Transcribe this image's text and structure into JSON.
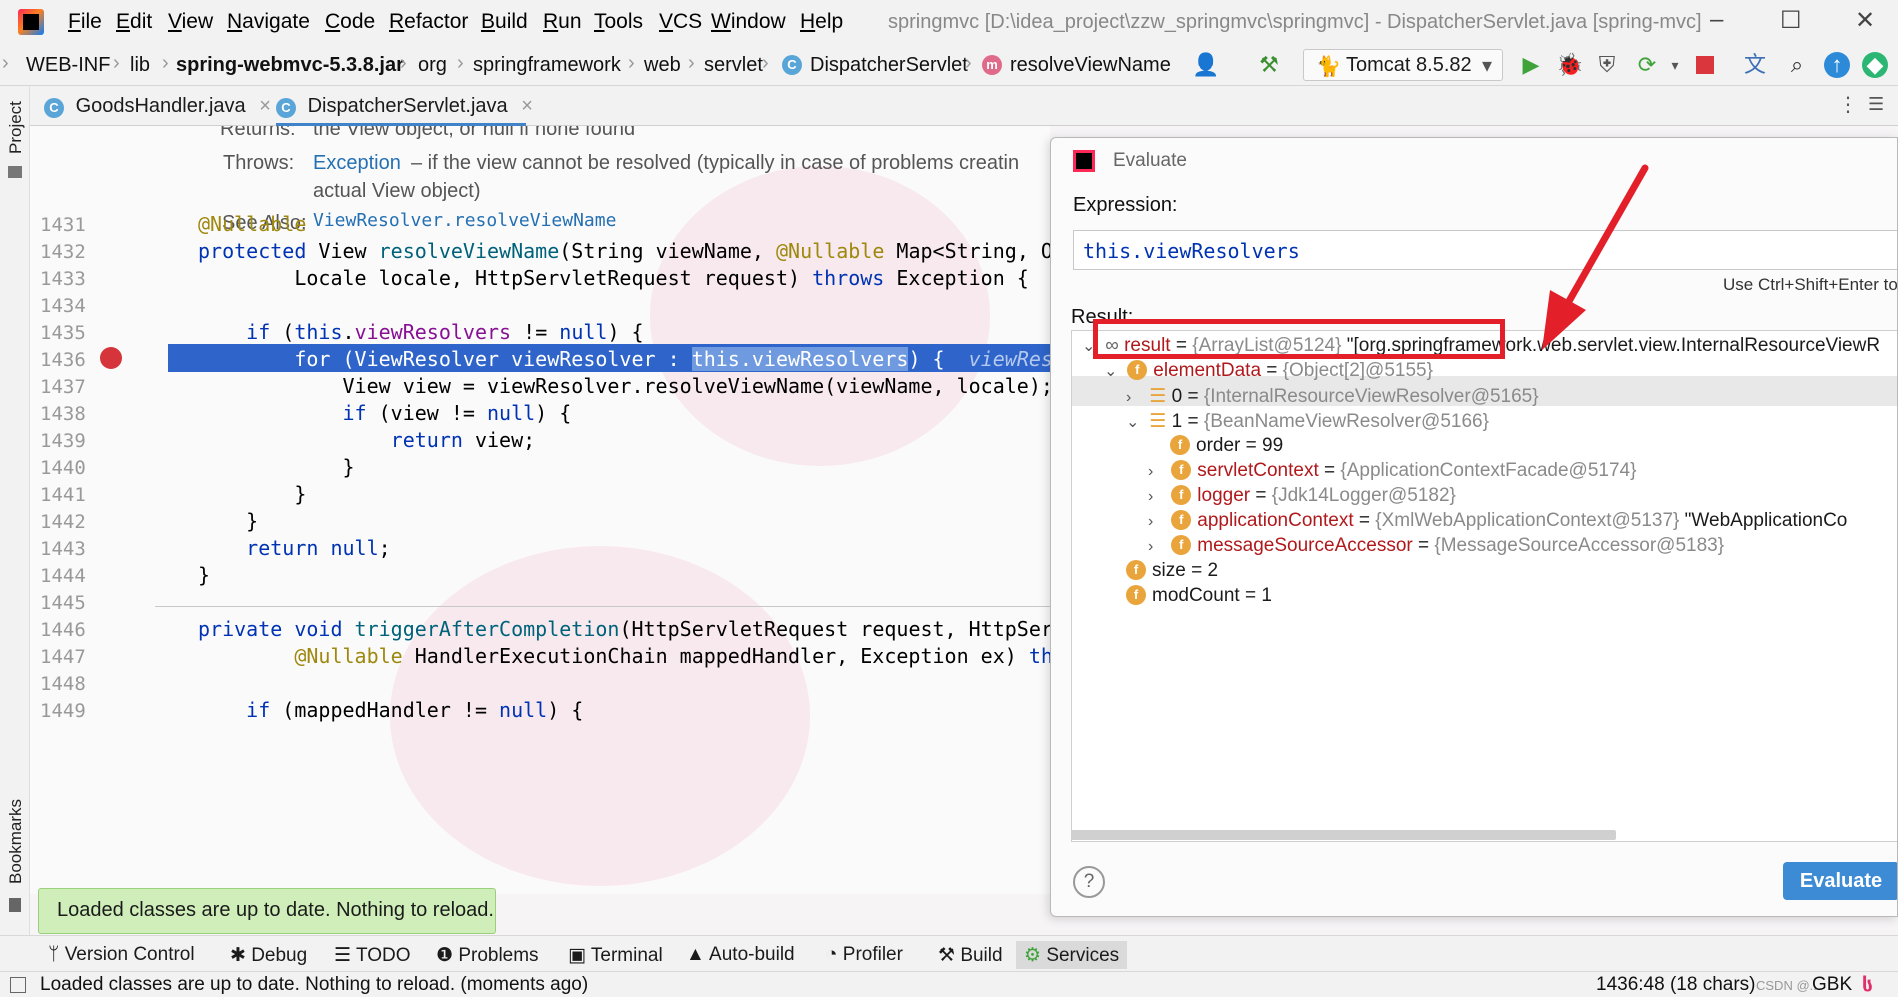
{
  "menubar": {
    "items": [
      "File",
      "Edit",
      "View",
      "Navigate",
      "Code",
      "Refactor",
      "Build",
      "Run",
      "Tools",
      "VCS",
      "Window",
      "Help"
    ],
    "window_title": "springmvc [D:\\idea_project\\zzw_springmvc\\springmvc] - DispatcherServlet.java [spring-mvc]",
    "controls": [
      "–",
      "☐",
      "✕"
    ]
  },
  "navbar": {
    "crumbs": [
      "WEB-INF",
      "lib",
      "spring-webmvc-5.3.8.jar",
      "org",
      "springframework",
      "web",
      "servlet",
      "DispatcherServlet",
      "resolveViewName"
    ],
    "run_config": "Tomcat 8.5.82"
  },
  "leftstrip": {
    "project": "Project",
    "bookmarks": "Bookmarks"
  },
  "tabs": [
    {
      "label": "GoodsHandler.java"
    },
    {
      "label": "DispatcherServlet.java"
    }
  ],
  "editor": {
    "doc": {
      "returns_label": "Returns:",
      "returns_text": "the View object, or null if none found",
      "throws_label": "Throws:",
      "throws_link": "Exception",
      "throws_text": " – if the view cannot be resolved (typically in case of problems creatin",
      "throws_text2": "actual View object)",
      "see_label": "See Also:",
      "see_link": "ViewResolver.resolveViewName"
    },
    "line_numbers": [
      "1431",
      "1432",
      "1433",
      "1434",
      "1435",
      "1436",
      "1437",
      "1438",
      "1439",
      "1440",
      "1441",
      "1442",
      "1443",
      "1444",
      "1445",
      "1446",
      "1447",
      "1448",
      "1449"
    ],
    "lines": {
      "l1431": "@Nullable",
      "l1432a": "protected",
      "l1432b": " View ",
      "l1432c": "resolveViewName",
      "l1432d": "(String viewName, ",
      "l1432e": "@Nullable",
      "l1432f": " Map<String, O",
      "l1433a": "        Locale locale, HttpServletRequest request) ",
      "l1433b": "throws",
      "l1433c": " Exception {",
      "l1435a": "    if",
      "l1435b": " (",
      "l1435c": "this",
      "l1435d": ".",
      "l1435e": "viewResolvers",
      "l1435f": " != ",
      "l1435g": "null",
      "l1435h": ") {",
      "l1436a": "        for (ViewResolver viewResolver : ",
      "l1436b": "this.viewResolvers",
      "l1436c": ") {  ",
      "l1436d": "viewRes",
      "l1437": "            View view = viewResolver.resolveViewName(viewName, locale);",
      "l1438a": "            if",
      "l1438b": " (view != ",
      "l1438c": "null",
      "l1438d": ") {",
      "l1439a": "                return",
      "l1439b": " view;",
      "l1440": "            }",
      "l1441": "        }",
      "l1442": "    }",
      "l1443a": "    return",
      "l1443b": " ",
      "l1443c": "null",
      "l1443d": ";",
      "l1444": "}",
      "l1446a": "private void",
      "l1446b": " ",
      "l1446c": "triggerAfterCompletion",
      "l1446d": "(HttpServletRequest request, HttpSer",
      "l1447a": "        ",
      "l1447b": "@Nullable",
      "l1447c": " HandlerExecutionChain mappedHandler, Exception ex) ",
      "l1447d": "th",
      "l1449a": "    if",
      "l1449b": " (mappedHandler != ",
      "l1449c": "null",
      "l1449d": ") {"
    }
  },
  "evaluate": {
    "title": "Evaluate",
    "expression_label": "Expression:",
    "expression": "this.viewResolvers",
    "hint": "Use Ctrl+Shift+Enter to",
    "result_label": "Result:",
    "tree": {
      "result_name": "result",
      "result_type": "{ArrayList@5124}",
      "result_value": "\"[org.springframework.web.servlet.view.InternalResourceViewR",
      "elementData_name": "elementData",
      "elementData_type": "{Object[2]@5155}",
      "item0": "0 = ",
      "item0_type": "{InternalResourceViewResolver@5165}",
      "item1": "1 = ",
      "item1_type": "{BeanNameViewResolver@5166}",
      "order": "order = 99",
      "servletContext_name": "servletContext",
      "servletContext_type": "{ApplicationContextFacade@5174}",
      "logger_name": "logger",
      "logger_type": "{Jdk14Logger@5182}",
      "applicationContext_name": "applicationContext",
      "applicationContext_type": "{XmlWebApplicationContext@5137}",
      "applicationContext_value": "\"WebApplicationCo",
      "messageSourceAccessor_name": "messageSourceAccessor",
      "messageSourceAccessor_type": "{MessageSourceAccessor@5183}",
      "size": "size = 2",
      "modCount": "modCount = 1"
    },
    "eq": " = ",
    "evaluate_button": "Evaluate",
    "help": "?"
  },
  "toast": "Loaded classes are up to date. Nothing to reload.",
  "toolwindows": [
    "Version Control",
    "Debug",
    "TODO",
    "Problems",
    "Terminal",
    "Auto-build",
    "Profiler",
    "Build",
    "Services"
  ],
  "status": {
    "message": "Loaded classes are up to date. Nothing to reload. (moments ago)",
    "position": "1436:48 (18 chars)",
    "encoding": "GBK",
    "watermark": "CSDN @..."
  },
  "colors": {
    "accent": "#2f65ca",
    "highlight_box": "#e3202a",
    "evaluate_button": "#3d8bd4"
  }
}
